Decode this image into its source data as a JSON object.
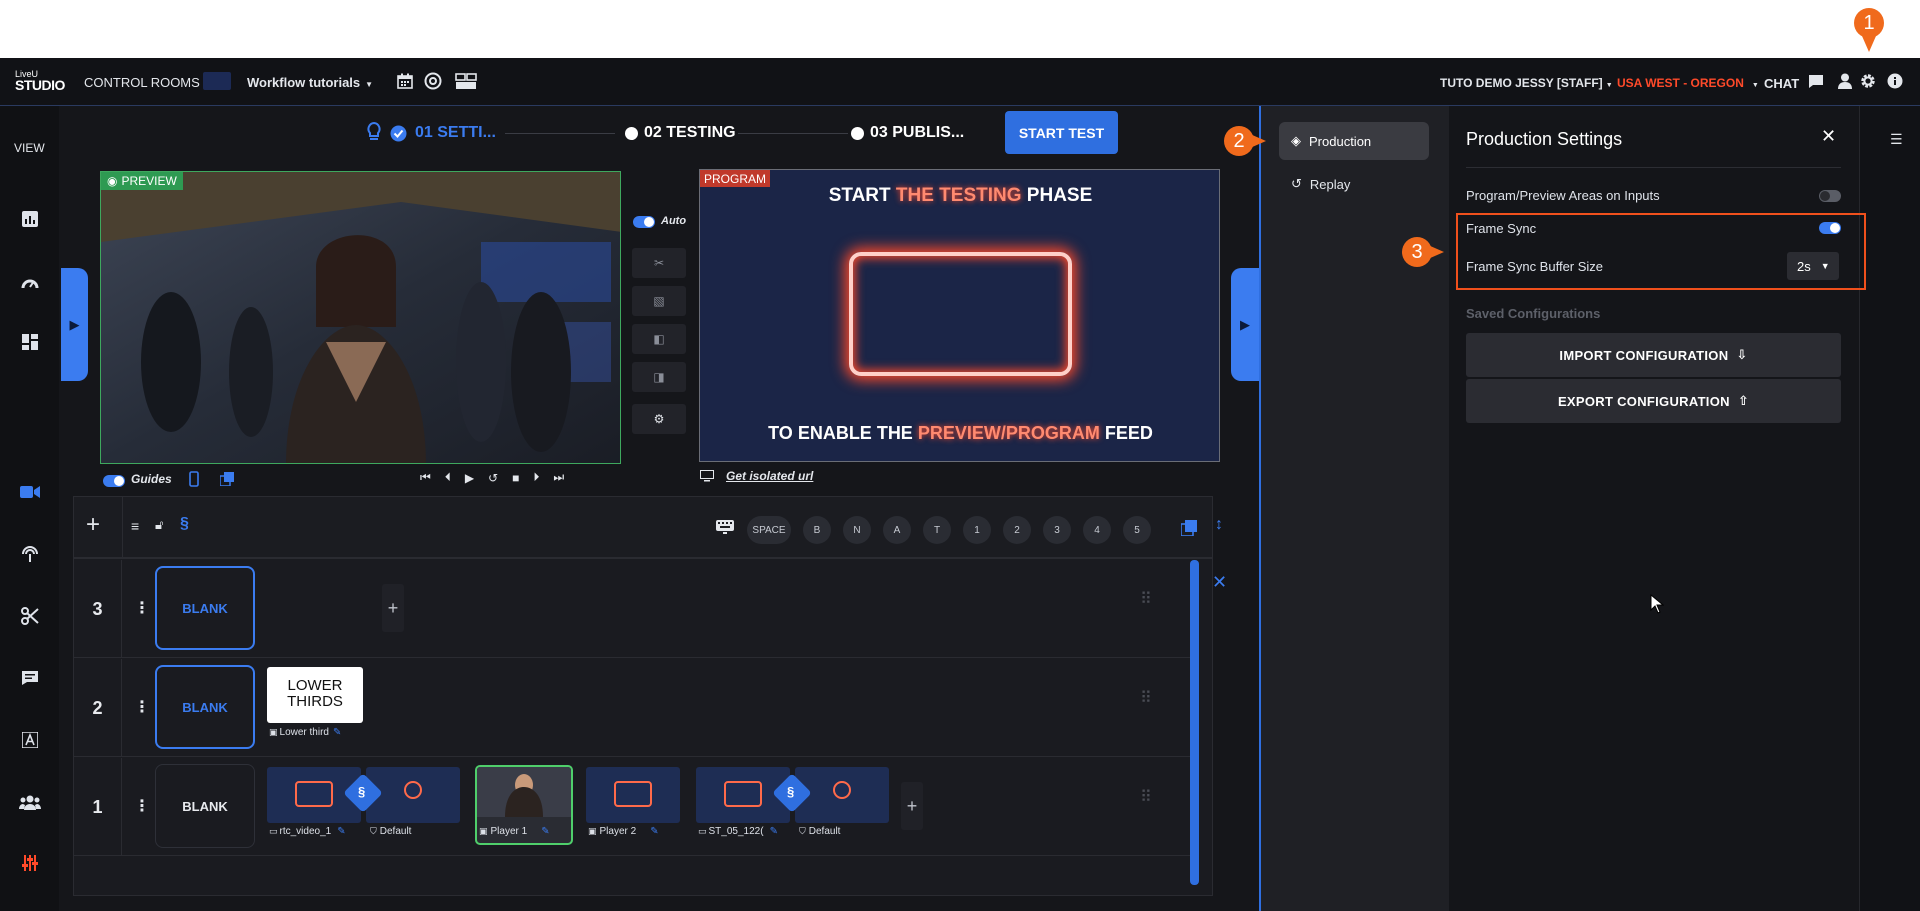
{
  "header": {
    "logo_top": "LiveU",
    "logo_bottom": "STUDIO",
    "control_rooms": "CONTROL ROOMS",
    "room_name": "Workflow tutorials",
    "user": "TUTO DEMO JESSY [STAFF]",
    "region": "USA WEST - OREGON",
    "chat": "CHAT",
    "accent_color": "#ff4a2a"
  },
  "rail": {
    "view_label": "VIEW",
    "icons": [
      "chart-icon",
      "gauge-icon",
      "dashboard-icon",
      "camera-icon",
      "broadcast-icon",
      "scissors-icon",
      "message-icon",
      "text-icon",
      "users-icon",
      "mixer-icon"
    ]
  },
  "stepper": {
    "step1": "01 SETTI...",
    "step2": "02 TESTING",
    "step3": "03 PUBLIS...",
    "start_test": "START TEST"
  },
  "preview": {
    "badge": "PREVIEW",
    "auto_label": "Auto",
    "guides_label": "Guides"
  },
  "program": {
    "badge": "PROGRAM",
    "line1_a": "START ",
    "line1_b": "THE TESTING",
    "line1_c": " PHASE",
    "line2_a": "TO ENABLE THE ",
    "line2_b": "PREVIEW/PROGRAM",
    "line2_c": " FEED",
    "isolated_link": "Get isolated url"
  },
  "keys": [
    "SPACE",
    "B",
    "N",
    "A",
    "T",
    "1",
    "2",
    "3",
    "4",
    "5"
  ],
  "rows": [
    {
      "num": "3",
      "blank": "BLANK"
    },
    {
      "num": "2",
      "blank": "BLANK",
      "graphic": "LOWER\nTHIRDS",
      "graphic_label": "Lower third"
    },
    {
      "num": "1",
      "blank": "BLANK",
      "sources": [
        {
          "label": "rtc_video_1"
        },
        {
          "label": "Default"
        },
        {
          "label": "Player 1"
        },
        {
          "label": "Player 2"
        },
        {
          "label": "ST_05_122("
        },
        {
          "label": "Default"
        }
      ]
    }
  ],
  "menu": {
    "production": "Production",
    "replay": "Replay"
  },
  "settings": {
    "title": "Production Settings",
    "program_preview": "Program/Preview Areas on Inputs",
    "frame_sync": "Frame Sync",
    "frame_sync_buffer": "Frame Sync Buffer Size",
    "buffer_value": "2s",
    "saved_configs": "Saved Configurations",
    "import_btn": "IMPORT CONFIGURATION",
    "export_btn": "EXPORT CONFIGURATION",
    "frame_sync_on": true,
    "program_preview_on": false
  },
  "markers": [
    "1",
    "2",
    "3"
  ]
}
